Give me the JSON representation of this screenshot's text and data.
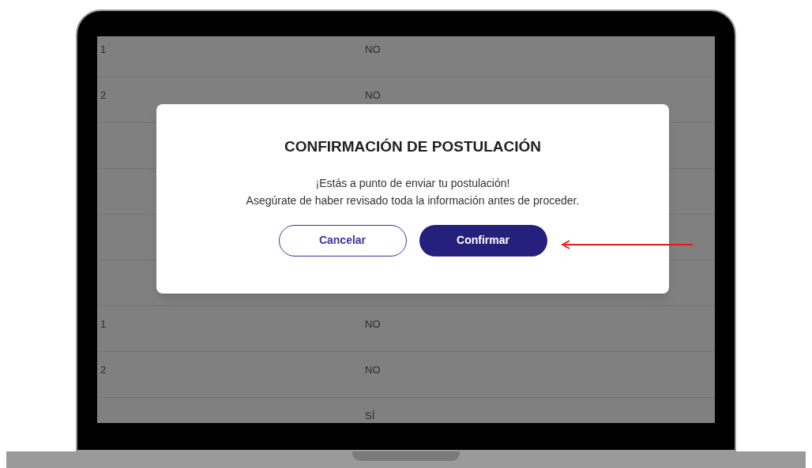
{
  "table": {
    "rows": [
      {
        "kind": "text",
        "column_1": "1",
        "column_2": "NO"
      },
      {
        "kind": "text",
        "column_1": "2",
        "column_2": "NO"
      },
      {
        "kind": "blank"
      },
      {
        "kind": "blank"
      },
      {
        "kind": "blank"
      },
      {
        "kind": "blank"
      },
      {
        "kind": "text",
        "column_1": "1",
        "column_2": "NO"
      },
      {
        "kind": "text",
        "column_1": "2",
        "column_2": "NO"
      },
      {
        "kind": "text",
        "column_2": "SÍ"
      }
    ]
  },
  "dialog": {
    "title": "CONFIRMACIÓN DE POSTULACIÓN",
    "message": [
      "¡Estás a punto de enviar tu postulación!",
      "Asegúrate de haber revisado toda la información antes de proceder."
    ],
    "buttons": [
      {
        "label": "Cancelar",
        "kind": "outline"
      },
      {
        "label": "Confirmar",
        "kind": "filled"
      }
    ]
  }
}
